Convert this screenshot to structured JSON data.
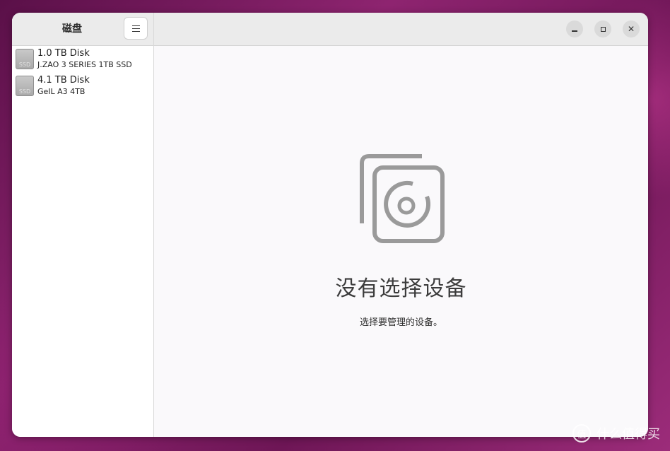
{
  "app": {
    "title": "磁盘"
  },
  "toolbar": {
    "menu_icon": "hamburger-menu-icon"
  },
  "window_controls": {
    "minimize_icon": "minimize-icon",
    "maximize_icon": "maximize-icon",
    "close_icon": "close-icon",
    "close_glyph": "✕"
  },
  "disks": [
    {
      "name": "1.0 TB Disk",
      "model": "J.ZAO 3 SERIES 1TB SSD",
      "icon_label": "SSD"
    },
    {
      "name": "4.1 TB Disk",
      "model": "GeIL A3 4TB",
      "icon_label": "SSD"
    }
  ],
  "empty_state": {
    "icon": "disk-placeholder-icon",
    "title": "没有选择设备",
    "description": "选择要管理的设备。"
  },
  "watermark": {
    "logo_glyph": "值",
    "text": "什么值得买"
  },
  "colors": {
    "icon_gray": "#9a9a9a",
    "header_bg": "#ebebeb",
    "content_bg": "#faf9fb"
  }
}
